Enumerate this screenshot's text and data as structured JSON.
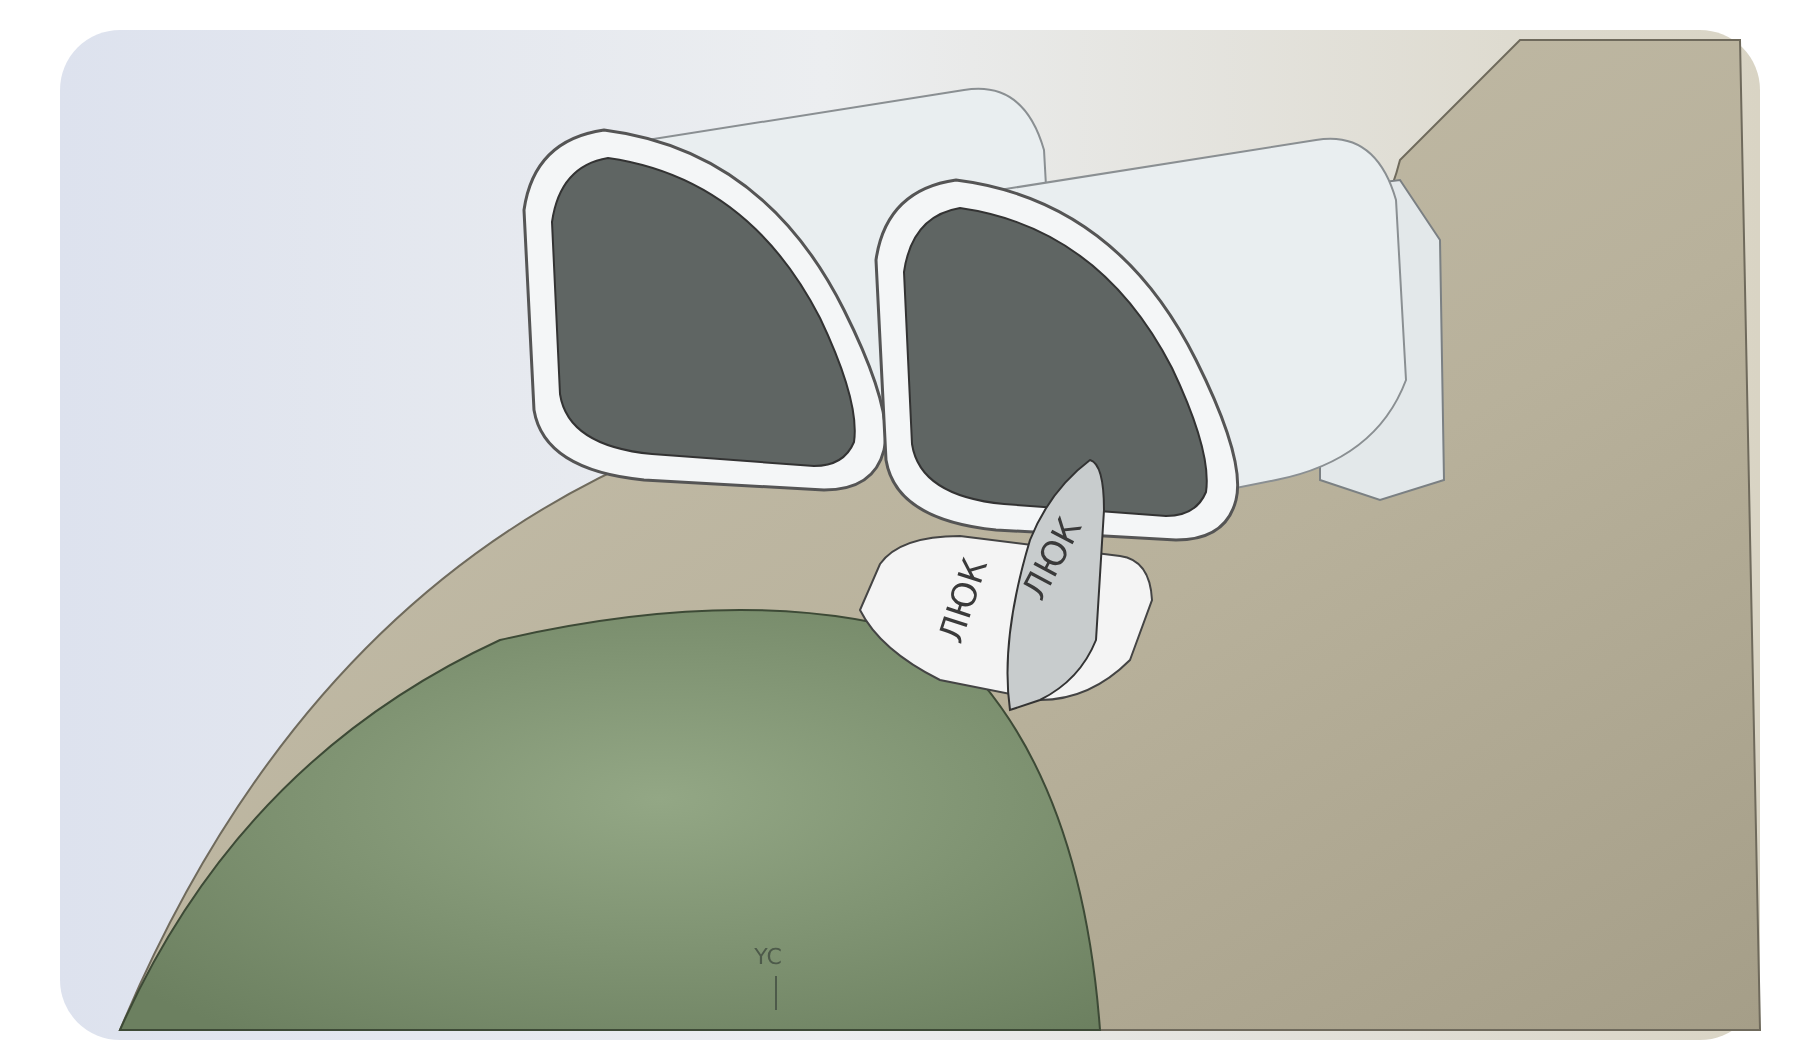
{
  "scene": {
    "labels": [
      {
        "kind": "hatch-frame",
        "text": "ЛЮК"
      },
      {
        "kind": "hatch-cover",
        "text": "ЛЮК"
      },
      {
        "kind": "axis",
        "text": "YC"
      }
    ]
  }
}
